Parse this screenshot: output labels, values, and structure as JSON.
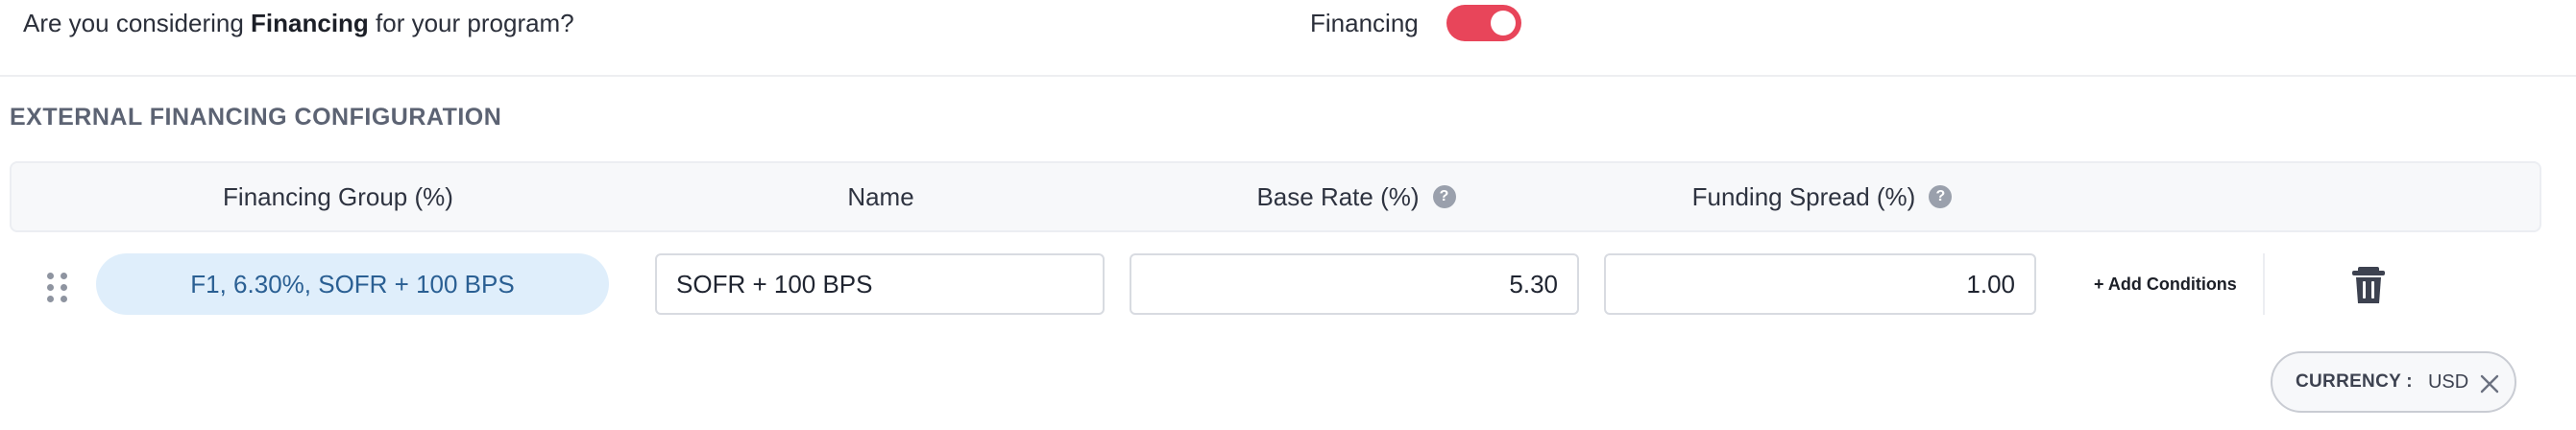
{
  "question": {
    "prefix": "Are you considering ",
    "emphasis": "Financing",
    "suffix": " for your program?"
  },
  "financing_toggle": {
    "label": "Financing",
    "enabled": true,
    "color": "#e8455a"
  },
  "section": {
    "title": "EXTERNAL FINANCING CONFIGURATION"
  },
  "table": {
    "headers": {
      "group": "Financing Group (%)",
      "name": "Name",
      "base_rate": "Base Rate (%)",
      "funding_spread": "Funding Spread (%)"
    },
    "help_icon_glyph": "?",
    "rows": [
      {
        "group": "F1, 6.30%, SOFR + 100 BPS",
        "name": "SOFR + 100 BPS",
        "base_rate": "5.30",
        "funding_spread": "1.00",
        "add_conditions": "+ Add Conditions",
        "delete_icon": "trash-icon",
        "drag_icon": "drag-handle-icon"
      }
    ]
  },
  "currency": {
    "label": "CURRENCY :",
    "value": "USD",
    "close_icon": "close-icon"
  }
}
